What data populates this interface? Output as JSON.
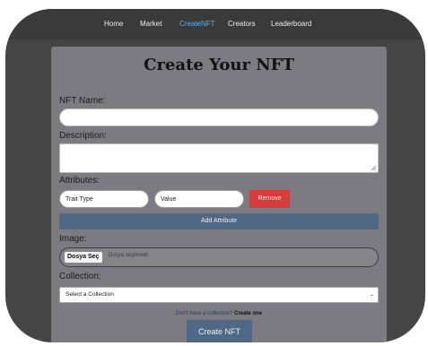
{
  "nav": {
    "items": [
      "Home",
      "Market",
      "CreateNFT",
      "Creators",
      "Leaderboard"
    ],
    "active_color": "#5ab1f0"
  },
  "form": {
    "title": "Create Your NFT",
    "name_label": "NFT Name:",
    "description_label": "Description:",
    "attributes_label": "Attributes:",
    "trait_type_value": "Trait Type",
    "value_value": "Value",
    "remove_label": "Remove",
    "add_attribute_label": "Add Attribute",
    "image_label": "Image:",
    "file_button_label": "Dosya Seç",
    "file_status": "Dosya seçilmedi",
    "collection_label": "Collection:",
    "collection_selected": "Select a Collection",
    "no_collection_text": "Don't have a collection?",
    "create_collection_link": "Create one",
    "submit_label": "Create NFT"
  },
  "colors": {
    "remove_red": "#d83b3b",
    "primary_blue": "#4e6885"
  }
}
